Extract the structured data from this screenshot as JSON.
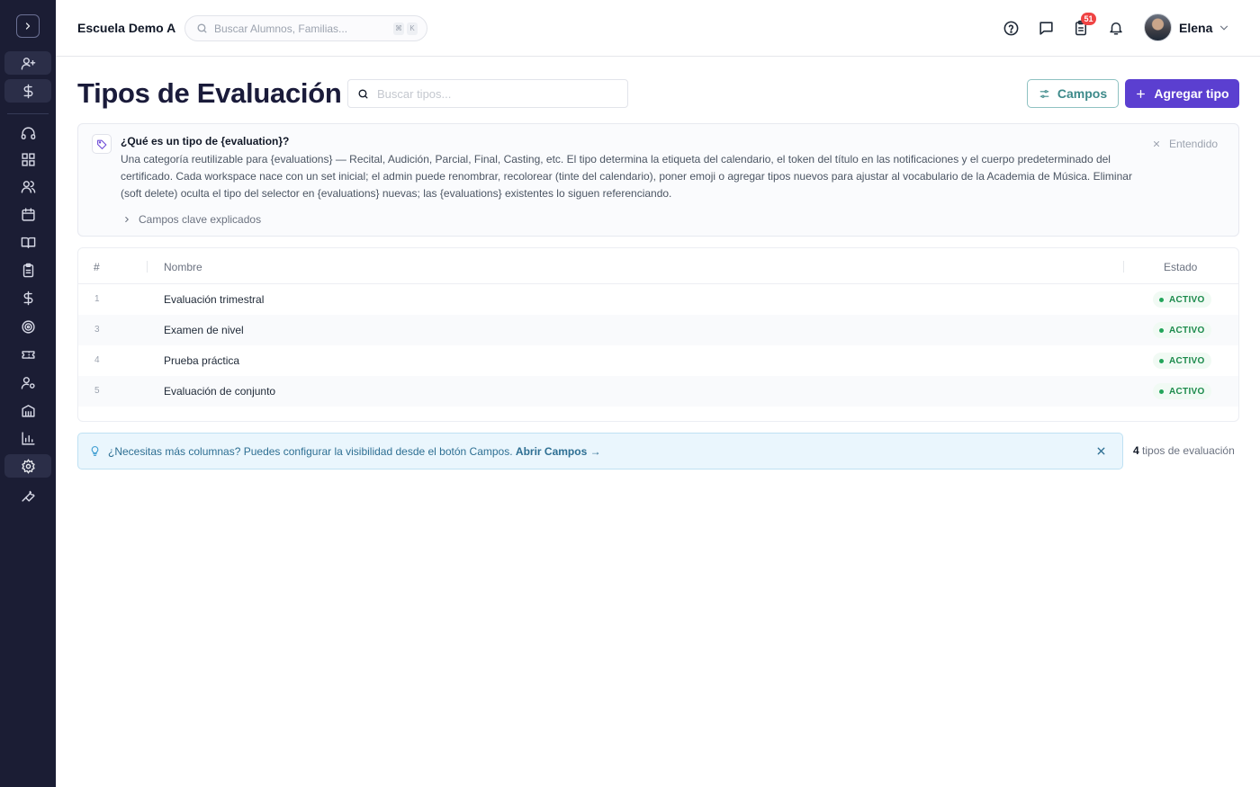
{
  "topbar": {
    "school_name": "Escuela Demo A",
    "search_placeholder": "Buscar Alumnos, Familias...",
    "kbd_1": "⌘",
    "kbd_2": "K",
    "tasks_badge": "51",
    "user_name": "Elena"
  },
  "sidebar": {
    "items": [
      "expand",
      "add-user",
      "dollar",
      "headset",
      "dashboard",
      "users",
      "calendar",
      "book",
      "clipboard",
      "dollar",
      "target",
      "ticket",
      "user-settings",
      "building",
      "chart",
      "settings",
      "wrench"
    ]
  },
  "header": {
    "title": "Tipos de Evaluación",
    "search_placeholder": "Buscar tipos...",
    "campos_label": "Campos",
    "add_label": "Agregar tipo"
  },
  "info": {
    "title": "¿Qué es un tipo de {evaluation}?",
    "body": "Una categoría reutilizable para {evaluations} — Recital, Audición, Parcial, Final, Casting, etc. El tipo determina la etiqueta del calendario, el token del título en las notificaciones y el cuerpo predeterminado del certificado. Cada workspace nace con un set inicial; el admin puede renombrar, recolorear (tinte del calendario), poner emoji o agregar tipos nuevos para ajustar al vocabulario de la Academia de Música. Eliminar (soft delete) oculta el tipo del selector en {evaluations} nuevas; las {evaluations} existentes lo siguen referenciando.",
    "fields_link": "Campos clave explicados",
    "dismiss": "Entendido"
  },
  "table": {
    "columns": {
      "num": "#",
      "name": "Nombre",
      "status": "Estado"
    },
    "rows": [
      {
        "num": "1",
        "name": "Evaluación trimestral",
        "status": "ACTIVO"
      },
      {
        "num": "3",
        "name": "Examen de nivel",
        "status": "ACTIVO"
      },
      {
        "num": "4",
        "name": "Prueba práctica",
        "status": "ACTIVO"
      },
      {
        "num": "5",
        "name": "Evaluación de conjunto",
        "status": "ACTIVO"
      }
    ]
  },
  "tip": {
    "message": "¿Necesitas más columnas? Puedes configurar la visibilidad desde el botón Campos.",
    "link": "Abrir Campos →"
  },
  "footer": {
    "count": "4",
    "count_label": "tipos de evaluación"
  },
  "colors": {
    "sidebar_bg": "#1b1d34",
    "primary": "#5b3fd0",
    "accent_teal": "#3d8a8a",
    "status_green": "#1b8a4b",
    "badge_red": "#ef4444"
  }
}
